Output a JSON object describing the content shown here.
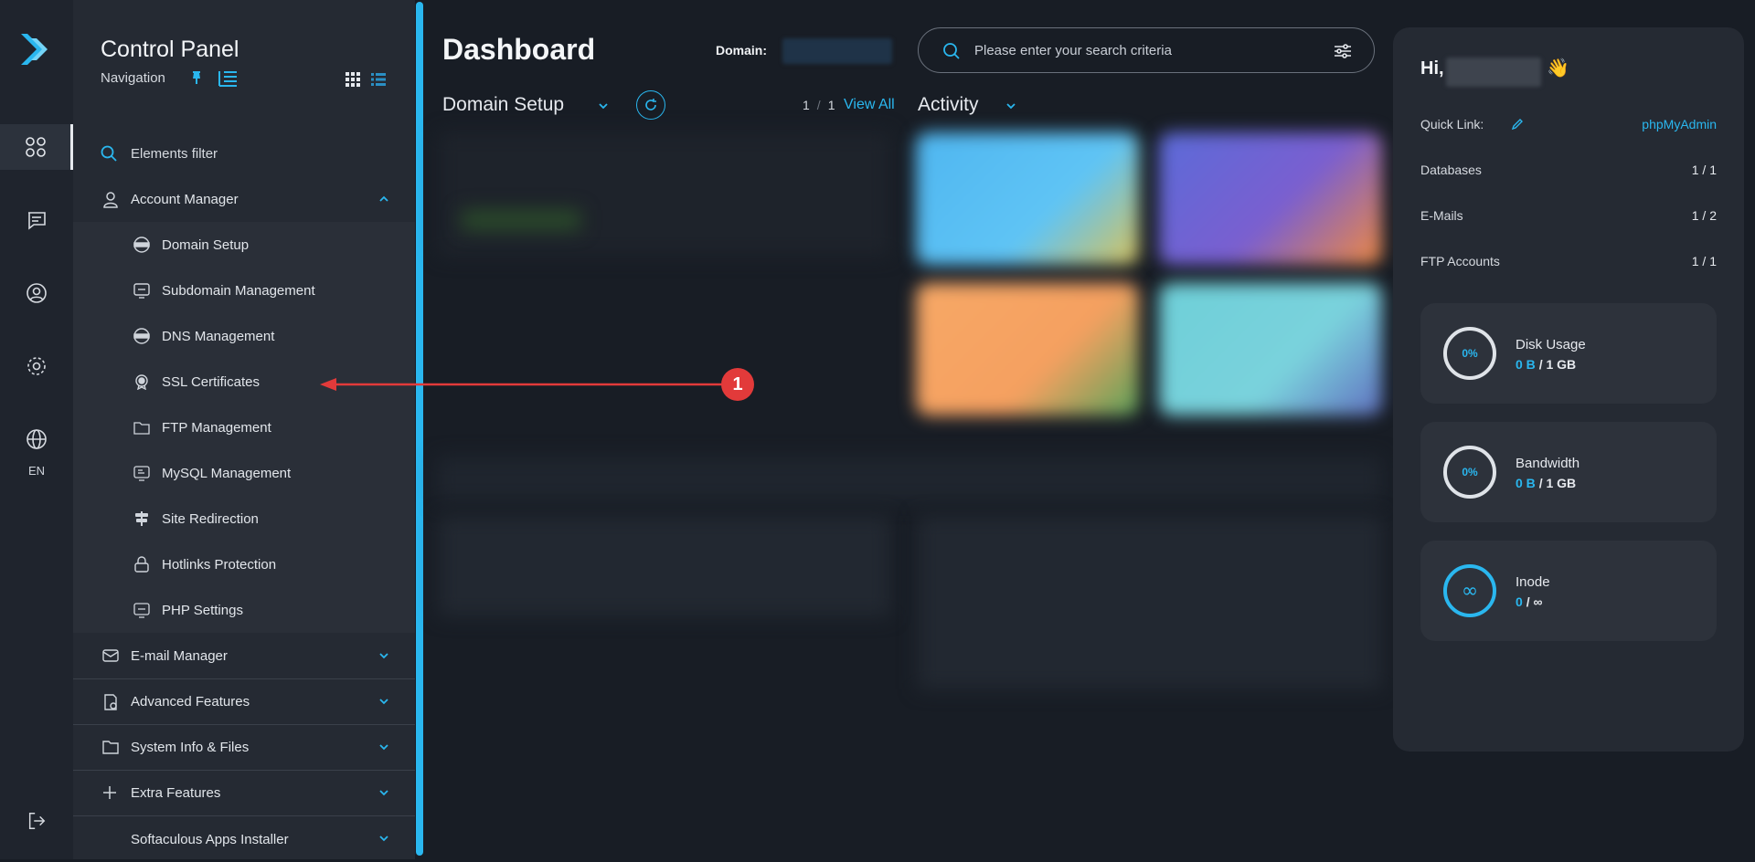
{
  "rail": {
    "language": "EN"
  },
  "nav": {
    "title": "Control Panel",
    "subtitle": "Navigation",
    "filter_label": "Elements filter",
    "sections_top": [
      {
        "label": "Account Manager"
      }
    ],
    "sub_items": [
      {
        "label": "Domain Setup"
      },
      {
        "label": "Subdomain Management"
      },
      {
        "label": "DNS Management"
      },
      {
        "label": "SSL Certificates"
      },
      {
        "label": "FTP Management"
      },
      {
        "label": "MySQL Management"
      },
      {
        "label": "Site Redirection"
      },
      {
        "label": "Hotlinks Protection"
      },
      {
        "label": "PHP Settings"
      }
    ],
    "sections_bottom": [
      {
        "label": "E-mail Manager"
      },
      {
        "label": "Advanced Features"
      },
      {
        "label": "System Info & Files"
      },
      {
        "label": "Extra Features"
      },
      {
        "label": "Softaculous Apps Installer"
      }
    ]
  },
  "header": {
    "title": "Dashboard",
    "domain_label": "Domain:",
    "search_placeholder": "Please enter your search criteria"
  },
  "domain_setup": {
    "title": "Domain Setup",
    "page_current": "1",
    "page_total": "1",
    "view_all": "View All"
  },
  "activity": {
    "title": "Activity"
  },
  "right_panel": {
    "greeting": "Hi,",
    "wave": "👋",
    "quick_link_label": "Quick Link:",
    "quick_link_value": "phpMyAdmin",
    "rows": [
      {
        "label": "Databases",
        "value": "1 / 1"
      },
      {
        "label": "E-Mails",
        "value": "1 / 2"
      },
      {
        "label": "FTP Accounts",
        "value": "1 / 1"
      }
    ],
    "stats": [
      {
        "label": "Disk Usage",
        "ring": "0%",
        "used": "0 B",
        "sep": "/",
        "total": "1 GB"
      },
      {
        "label": "Bandwidth",
        "ring": "0%",
        "used": "0 B",
        "sep": "/",
        "total": "1 GB"
      },
      {
        "label": "Inode",
        "ring": "∞",
        "used": "0",
        "sep": "/",
        "total": "∞"
      }
    ]
  },
  "annotation": {
    "badge": "1"
  },
  "colors": {
    "accent": "#2ab7ef",
    "marker": "#e23a3a"
  }
}
